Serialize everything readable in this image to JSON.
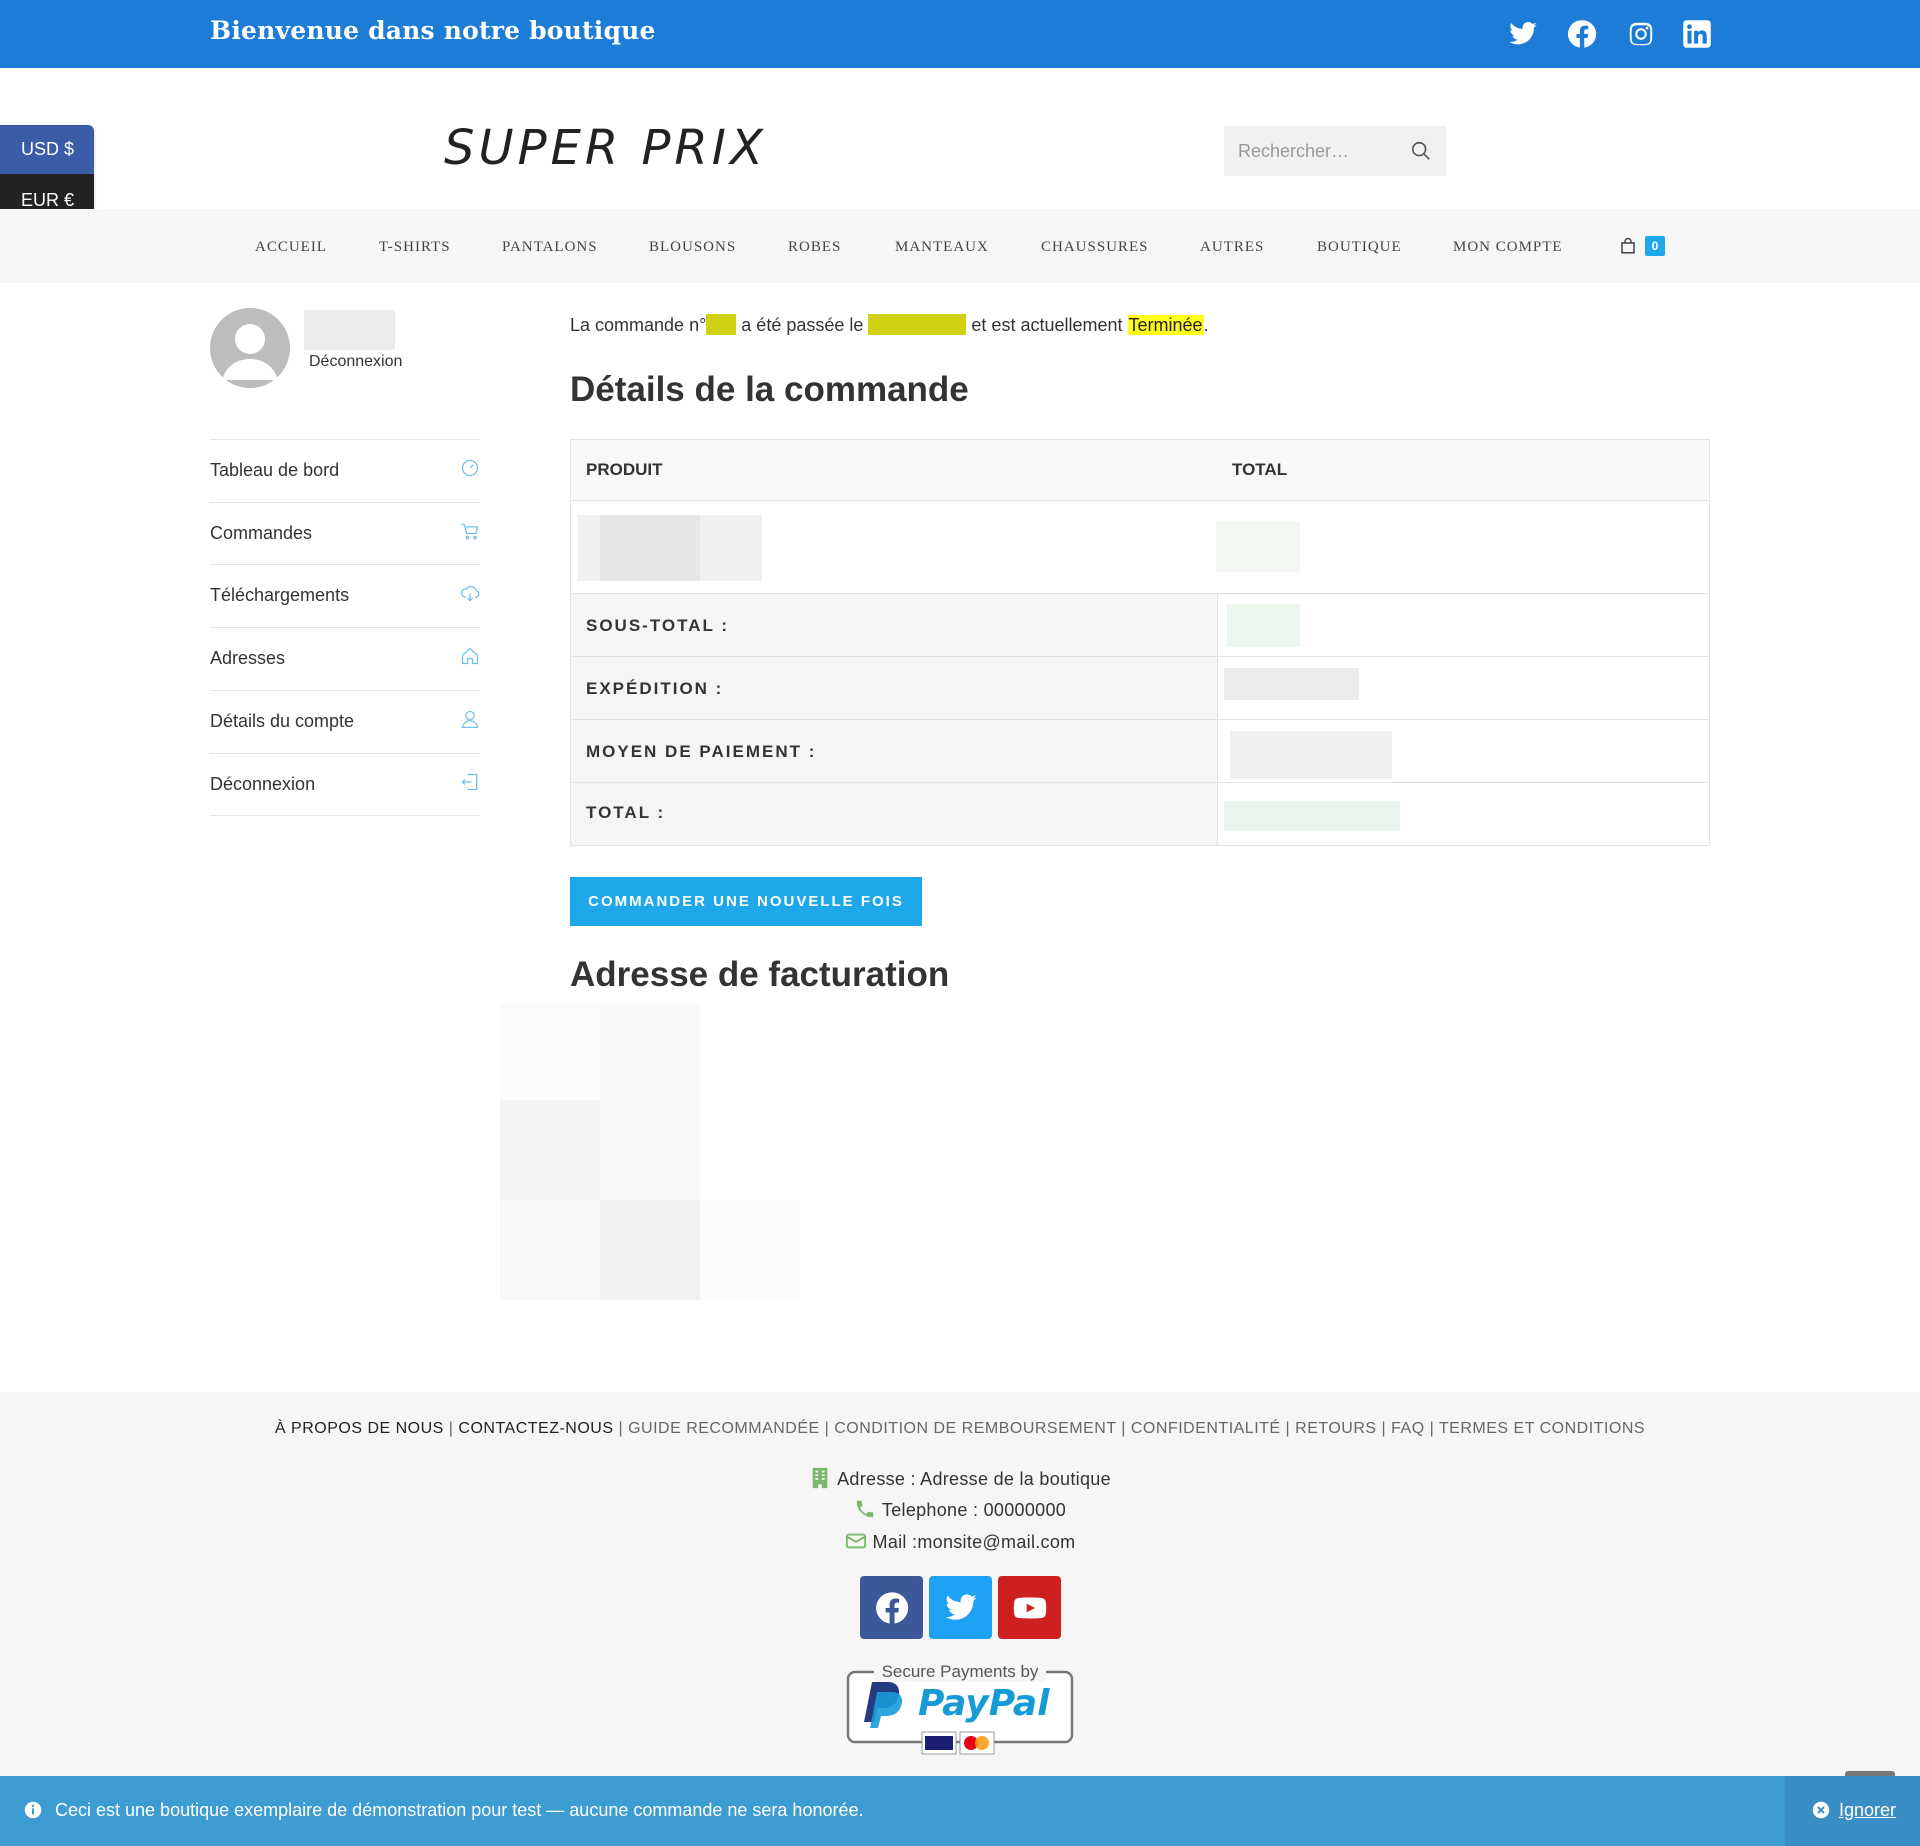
{
  "topbar": {
    "welcome": "Bienvenue dans notre boutique",
    "social_icons": [
      "twitter-icon",
      "facebook-icon",
      "instagram-icon",
      "linkedin-icon"
    ],
    "bg_color": "#1c7cd6"
  },
  "currency": {
    "usd": "USD $",
    "eur": "EUR €"
  },
  "header": {
    "logo": "SUPER PRIX",
    "search_placeholder": "Rechercher…"
  },
  "nav": {
    "items": [
      "ACCUEIL",
      "T-SHIRTS",
      "PANTALONS",
      "BLOUSONS",
      "ROBES",
      "MANTEAUX",
      "CHAUSSURES",
      "AUTRES",
      "BOUTIQUE",
      "MON COMPTE"
    ],
    "cart_count": "0"
  },
  "account": {
    "logout_small": "Déconnexion",
    "menu": [
      "Tableau de bord",
      "Commandes",
      "Téléchargements",
      "Adresses",
      "Détails du compte",
      "Déconnexion"
    ]
  },
  "order": {
    "line_part1": "La commande n°",
    "line_part2": "a été passée le",
    "line_part3": "et est actuellement",
    "status": "Terminée",
    "period": ".",
    "details_title": "Détails de la commande",
    "table": {
      "col_product": "PRODUIT",
      "col_total": "TOTAL",
      "subtotal": "SOUS-TOTAL :",
      "shipping": "EXPÉDITION :",
      "payment": "MOYEN DE PAIEMENT :",
      "total": "TOTAL :"
    },
    "reorder_button": "COMMANDER UNE NOUVELLE FOIS",
    "billing_title": "Adresse de facturation"
  },
  "footer": {
    "links_dark": [
      "À PROPOS DE NOUS",
      "CONTACTEZ-NOUS"
    ],
    "links": [
      "GUIDE RECOMMANDÉE",
      "CONDITION DE REMBOURSEMENT",
      "CONFIDENTIALITÉ",
      "RETOURS",
      "FAQ",
      "TERMES ET CONDITIONS"
    ],
    "address": "Adresse : Adresse de la boutique",
    "phone": "Telephone : 00000000",
    "mail": "Mail :monsite@mail.com",
    "social_buttons": [
      "facebook-icon",
      "twitter-icon",
      "youtube-icon"
    ],
    "paypal_caption": "Secure Payments by",
    "paypal_logo": "PayPal"
  },
  "notice": {
    "text": "Ceci est une boutique exemplaire de démonstration pour test — aucune commande ne sera honorée.",
    "dismiss": "Ignorer"
  },
  "colors": {
    "accent": "#1fa8e9",
    "highlight": "#ffff1a",
    "footer_icon_green": "#7ab86a"
  }
}
